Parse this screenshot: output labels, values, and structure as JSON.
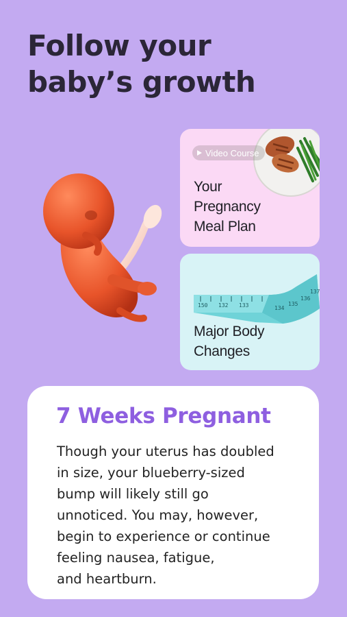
{
  "headline": {
    "line1": "Follow your",
    "line2": "baby’s growth"
  },
  "cards": {
    "meal": {
      "badge": "Video Course",
      "title_lines": [
        "Your",
        "Pregnancy",
        "Meal Plan"
      ]
    },
    "body": {
      "title_lines": [
        "Major Body",
        "Changes"
      ]
    }
  },
  "info": {
    "title": "7 Weeks Pregnant",
    "text_lines": [
      "Though your uterus has doubled",
      "in size, your blueberry-sized",
      "bump will likely still go",
      "unnoticed. You may, however,",
      "begin to experience or continue",
      "feeling nausea, fatigue,",
      "and heartburn."
    ]
  },
  "colors": {
    "background": "#c3aaf1",
    "headline": "#2b2637",
    "accent_title": "#8e5fe0",
    "meal_card": "#fbd9f5",
    "body_card": "#d8f3f6",
    "tape": "#6fd3d8"
  },
  "icons": {
    "badge_icon": "play-icon",
    "fetus": "fetus-illustration",
    "plate": "meal-plate-illustration",
    "tape": "measuring-tape-illustration"
  }
}
